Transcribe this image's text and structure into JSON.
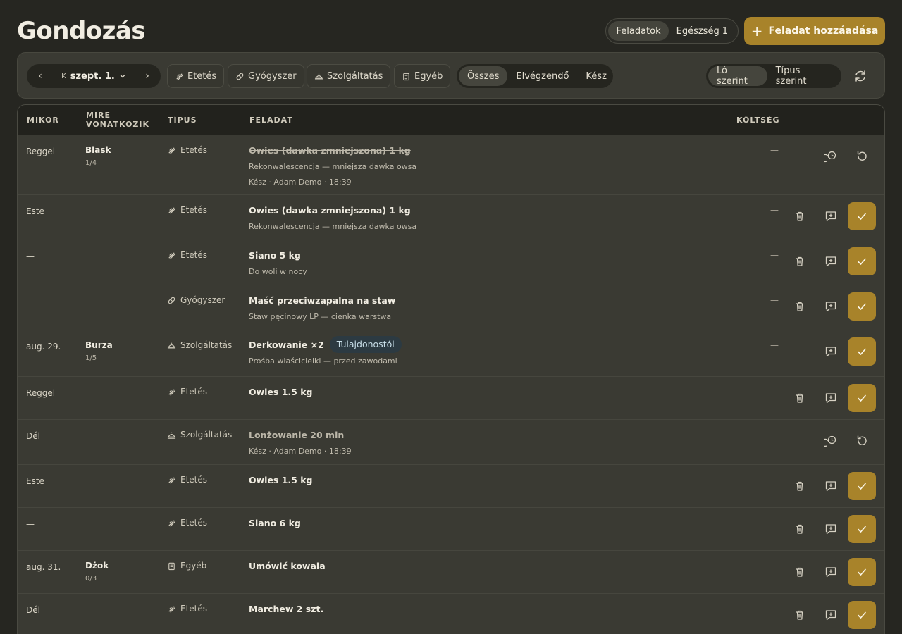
{
  "page": {
    "title": "Gondozás",
    "views": [
      {
        "label": "Feladatok",
        "badge": ""
      },
      {
        "label": "Egészség",
        "badge": "1"
      }
    ],
    "add_task": "Feladat hozzáadása"
  },
  "toolbar": {
    "date_prefix": "K",
    "date": "szept. 1.",
    "filters": [
      "Etetés",
      "Gyógyszer",
      "Szolgáltatás",
      "Egyéb"
    ],
    "status": [
      "Összes",
      "Elvégzendő",
      "Kész"
    ],
    "grouping": [
      "Ló szerint",
      "Típus szerint"
    ]
  },
  "table": {
    "headers": {
      "when": "MIKOR",
      "horse_1": "MIRE",
      "horse_2": "VONATKOZIK",
      "type": "TÍPUS",
      "task": "FELADAT",
      "cost": "KÖLTSÉG"
    },
    "rows": [
      {
        "when": "Reggel",
        "horse": "Blask",
        "progress": "1/4",
        "type": "Etetés",
        "icon": "feed-icon",
        "title": "Owies (dawka zmniejszona) 1 kg",
        "pill": "",
        "note": "Rekonwalescencja — mniejsza dawka owsa",
        "done_note": "Kész · Adam Demo · 18:39",
        "done": true,
        "cost": "—"
      },
      {
        "when": "Este",
        "horse": "",
        "progress": "",
        "type": "Etetés",
        "icon": "feed-icon",
        "title": "Owies (dawka zmniejszona) 1 kg",
        "pill": "",
        "note": "Rekonwalescencja — mniejsza dawka owsa",
        "done_note": "",
        "done": false,
        "cost": "—"
      },
      {
        "when": "—",
        "horse": "",
        "progress": "",
        "type": "Etetés",
        "icon": "feed-icon",
        "title": "Siano 5 kg",
        "pill": "",
        "note": "Do woli w nocy",
        "done_note": "",
        "done": false,
        "cost": "—"
      },
      {
        "when": "—",
        "horse": "",
        "progress": "",
        "type": "Gyógyszer",
        "icon": "medicine-icon",
        "title": "Maść przeciwzapalna na staw",
        "pill": "",
        "note": "Staw pęcinowy LP — cienka warstwa",
        "done_note": "",
        "done": false,
        "cost": "—"
      },
      {
        "when": "aug. 29.",
        "horse": "Burza",
        "progress": "1/5",
        "type": "Szolgáltatás",
        "icon": "service-icon",
        "title": "Derkowanie ×2",
        "pill": "Tulajdonostól",
        "note": "Prośba właścicielki — przed zawodami",
        "done_note": "",
        "done": false,
        "cost": "—"
      },
      {
        "when": "Reggel",
        "horse": "",
        "progress": "",
        "type": "Etetés",
        "icon": "feed-icon",
        "title": "Owies 1.5 kg",
        "pill": "",
        "note": "",
        "done_note": "",
        "done": false,
        "cost": "—"
      },
      {
        "when": "Dél",
        "horse": "",
        "progress": "",
        "type": "Szolgáltatás",
        "icon": "service-icon",
        "title": "Lonżowanie 20 min",
        "pill": "",
        "note": "",
        "done_note": "Kész · Adam Demo · 18:39",
        "done": true,
        "cost": "—"
      },
      {
        "when": "Este",
        "horse": "",
        "progress": "",
        "type": "Etetés",
        "icon": "feed-icon",
        "title": "Owies 1.5 kg",
        "pill": "",
        "note": "",
        "done_note": "",
        "done": false,
        "cost": "—"
      },
      {
        "when": "—",
        "horse": "",
        "progress": "",
        "type": "Etetés",
        "icon": "feed-icon",
        "title": "Siano 6 kg",
        "pill": "",
        "note": "",
        "done_note": "",
        "done": false,
        "cost": "—"
      },
      {
        "when": "aug. 31.",
        "horse": "Dżok",
        "progress": "0/3",
        "type": "Egyéb",
        "icon": "clipboard-icon",
        "title": "Umówić kowala",
        "pill": "",
        "note": "",
        "done_note": "",
        "done": false,
        "cost": "—"
      },
      {
        "when": "Dél",
        "horse": "",
        "progress": "",
        "type": "Etetés",
        "icon": "feed-icon",
        "title": "Marchew 2 szt.",
        "pill": "",
        "note": "",
        "done_note": "",
        "done": false,
        "cost": "—"
      }
    ]
  },
  "colors": {
    "accent": "#a8832a",
    "background": "#262621",
    "panel": "#3a3a33"
  }
}
